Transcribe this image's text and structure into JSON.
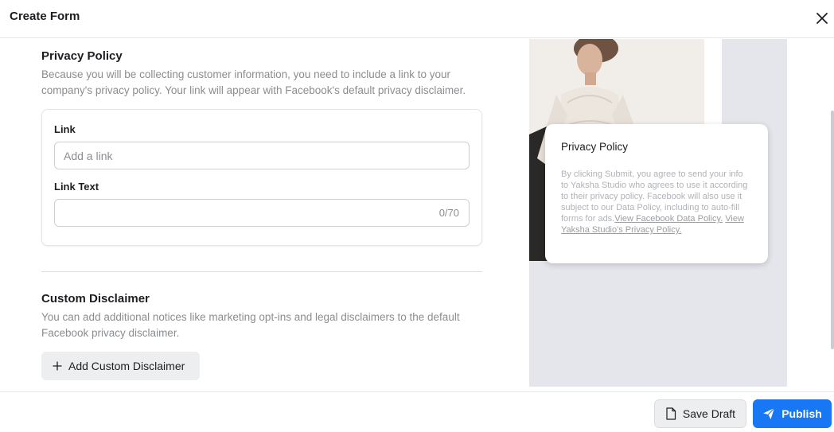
{
  "header": {
    "title": "Create Form",
    "close_icon": "close-icon"
  },
  "privacy_policy": {
    "title": "Privacy Policy",
    "description": "Because you will be collecting customer information, you need to include a link to your company's privacy policy. Your link will appear with Facebook's default privacy disclaimer.",
    "link_label": "Link",
    "link_value": "",
    "link_placeholder": "Add a link",
    "link_text_label": "Link Text",
    "link_text_value": "",
    "link_text_counter": "0/70"
  },
  "custom_disclaimer": {
    "title": "Custom Disclaimer",
    "description": "You can add additional notices like marketing opt-ins and legal disclaimers to the default Facebook privacy disclaimer.",
    "add_button_label": "Add Custom Disclaimer",
    "add_icon": "plus-icon"
  },
  "preview": {
    "card_title": "Privacy Policy",
    "disclaimer_text": "By clicking Submit, you agree to send your info to Yaksha Studio who agrees to use it according to their privacy policy. Facebook will also use it subject to our Data Policy, including to auto-fill forms for ads.",
    "link_data_policy": "View Facebook Data Policy.",
    "link_privacy_policy": "View Yaksha Studio's Privacy Policy."
  },
  "footer": {
    "save_draft_label": "Save Draft",
    "save_draft_icon": "document-icon",
    "publish_label": "Publish",
    "publish_icon": "send-icon"
  },
  "colors": {
    "primary": "#1877f2",
    "secondary_button": "#eceef0",
    "muted_text": "#8a8d91"
  }
}
